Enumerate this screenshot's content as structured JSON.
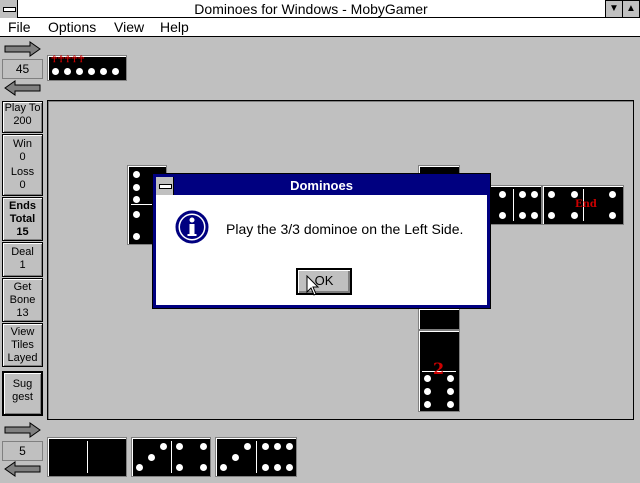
{
  "window": {
    "title": "Dominoes for Windows - MobyGamer"
  },
  "menu": {
    "file": "File",
    "options": "Options",
    "view": "View",
    "help": "Help"
  },
  "opponent": {
    "bones": "45"
  },
  "player": {
    "bones": "5"
  },
  "panel": {
    "play_to_label": "Play To",
    "play_to_value": "200",
    "win_label": "Win",
    "win_value": "0",
    "loss_label": "Loss",
    "loss_value": "0",
    "ends_label": "Ends",
    "total_label": "Total",
    "total_value": "15",
    "deal_label": "Deal",
    "deal_value": "1",
    "get_label": "Get",
    "bone_label": "Bone",
    "bone_value": "13",
    "view_label": "View",
    "tiles_label": "Tiles",
    "layed_label": "Layed",
    "sug_label": "Sug",
    "gest_label": "gest"
  },
  "dialog": {
    "title": "Dominoes",
    "message": "Play the 3/3 dominoe on the Left Side.",
    "ok_label": "OK"
  },
  "board": {
    "end_marker": "End",
    "spinner_marker": "2"
  },
  "colors": {
    "board": "#c0c0c0",
    "dialog_border": "#000080",
    "domino": "#000000",
    "marker": "#cc0000"
  }
}
